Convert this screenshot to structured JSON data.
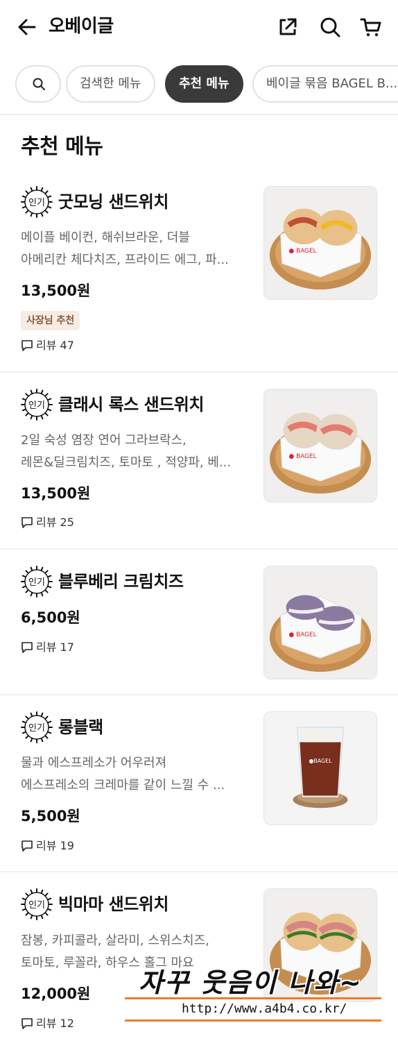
{
  "header": {
    "title": "오베이글",
    "icons": [
      "back-arrow-icon",
      "share-icon",
      "search-icon",
      "cart-icon"
    ]
  },
  "chips": [
    {
      "label": "검색한 메뉴",
      "active": false
    },
    {
      "label": "추천 메뉴",
      "active": true
    },
    {
      "label": "베이글 묶음 BAGEL B...",
      "active": false
    }
  ],
  "section_title": "추천 메뉴",
  "badge_label": "인기",
  "items": [
    {
      "name": "굿모닝 샌드위치",
      "desc": [
        "메이플 베이컨, 해쉬브라운, 더블",
        "아메리칸 체다치즈, 프라이드 에그, 파..."
      ],
      "price": "13,500원",
      "tag": "사장님 추천",
      "review": "리뷰 47"
    },
    {
      "name": "클래시 록스 샌드위치",
      "desc": [
        "2일 숙성 염장 연어 그라브락스,",
        "레몬&딜크림치즈, 토마토 , 적양파, 베..."
      ],
      "price": "13,500원",
      "review": "리뷰 25"
    },
    {
      "name": "블루베리 크림치즈",
      "desc": [],
      "price": "6,500원",
      "review": "리뷰 17"
    },
    {
      "name": "롱블랙",
      "desc": [
        "물과 에스프레소가 어우러져",
        "에스프레소의 크레마를 같이 느낄 수 ..."
      ],
      "price": "5,500원",
      "review": "리뷰 19"
    },
    {
      "name": "빅마마 샌드위치",
      "desc": [
        "잠봉, 카피콜라, 살라미, 스위스치즈,",
        "토마토, 루꼴라, 하우스 홀그 마요"
      ],
      "price": "12,000원",
      "review": "리뷰 12"
    }
  ],
  "watermark": {
    "text": "자꾸 웃음이 나와~",
    "url": "http://www.a4b4.co.kr/"
  },
  "colors": {
    "active_chip": "#3a3a3a",
    "tag_bg": "#f6ece4",
    "tag_text": "#8a5a3c",
    "watermark_line": "#f07a2a"
  }
}
